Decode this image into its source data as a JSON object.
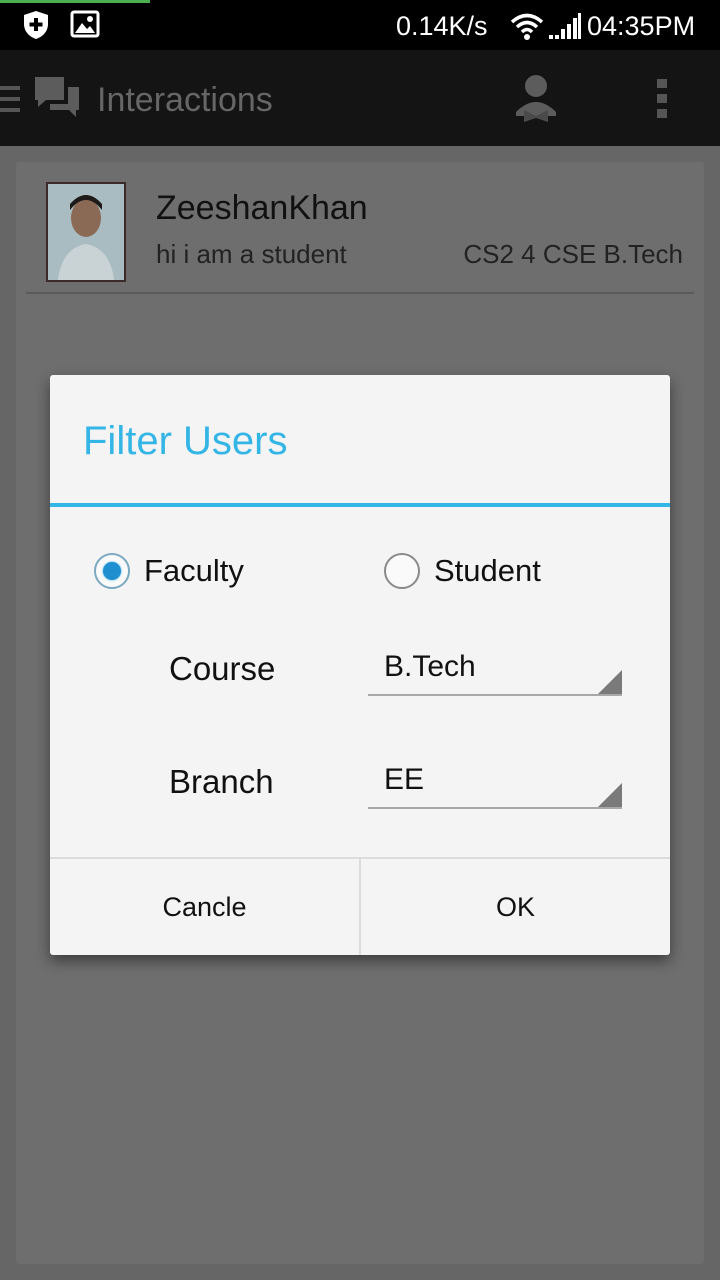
{
  "status_bar": {
    "speed": "0.14K/s",
    "time": "04:35PM",
    "icons": [
      "shield-plus-icon",
      "image-notification-icon",
      "wifi-icon",
      "signal-icon"
    ]
  },
  "action_bar": {
    "title": "Interactions",
    "icons": [
      "menu-icon",
      "chat-icon",
      "user-filter-icon",
      "overflow-menu-icon"
    ]
  },
  "user": {
    "name": "ZeeshanKhan",
    "status": "hi i am a student",
    "class": "CS2 4 CSE B.Tech"
  },
  "dialog": {
    "title": "Filter Users",
    "roles": {
      "faculty": "Faculty",
      "student": "Student",
      "selected": "Faculty"
    },
    "course_label": "Course",
    "course_value": "B.Tech",
    "branch_label": "Branch",
    "branch_value": "EE",
    "cancel_label": "Cancle",
    "ok_label": "OK"
  },
  "colors": {
    "accent": "#33b5e5",
    "overlay": "#666666",
    "action_bar": "#141414",
    "dialog_bg": "#f4f4f4"
  }
}
